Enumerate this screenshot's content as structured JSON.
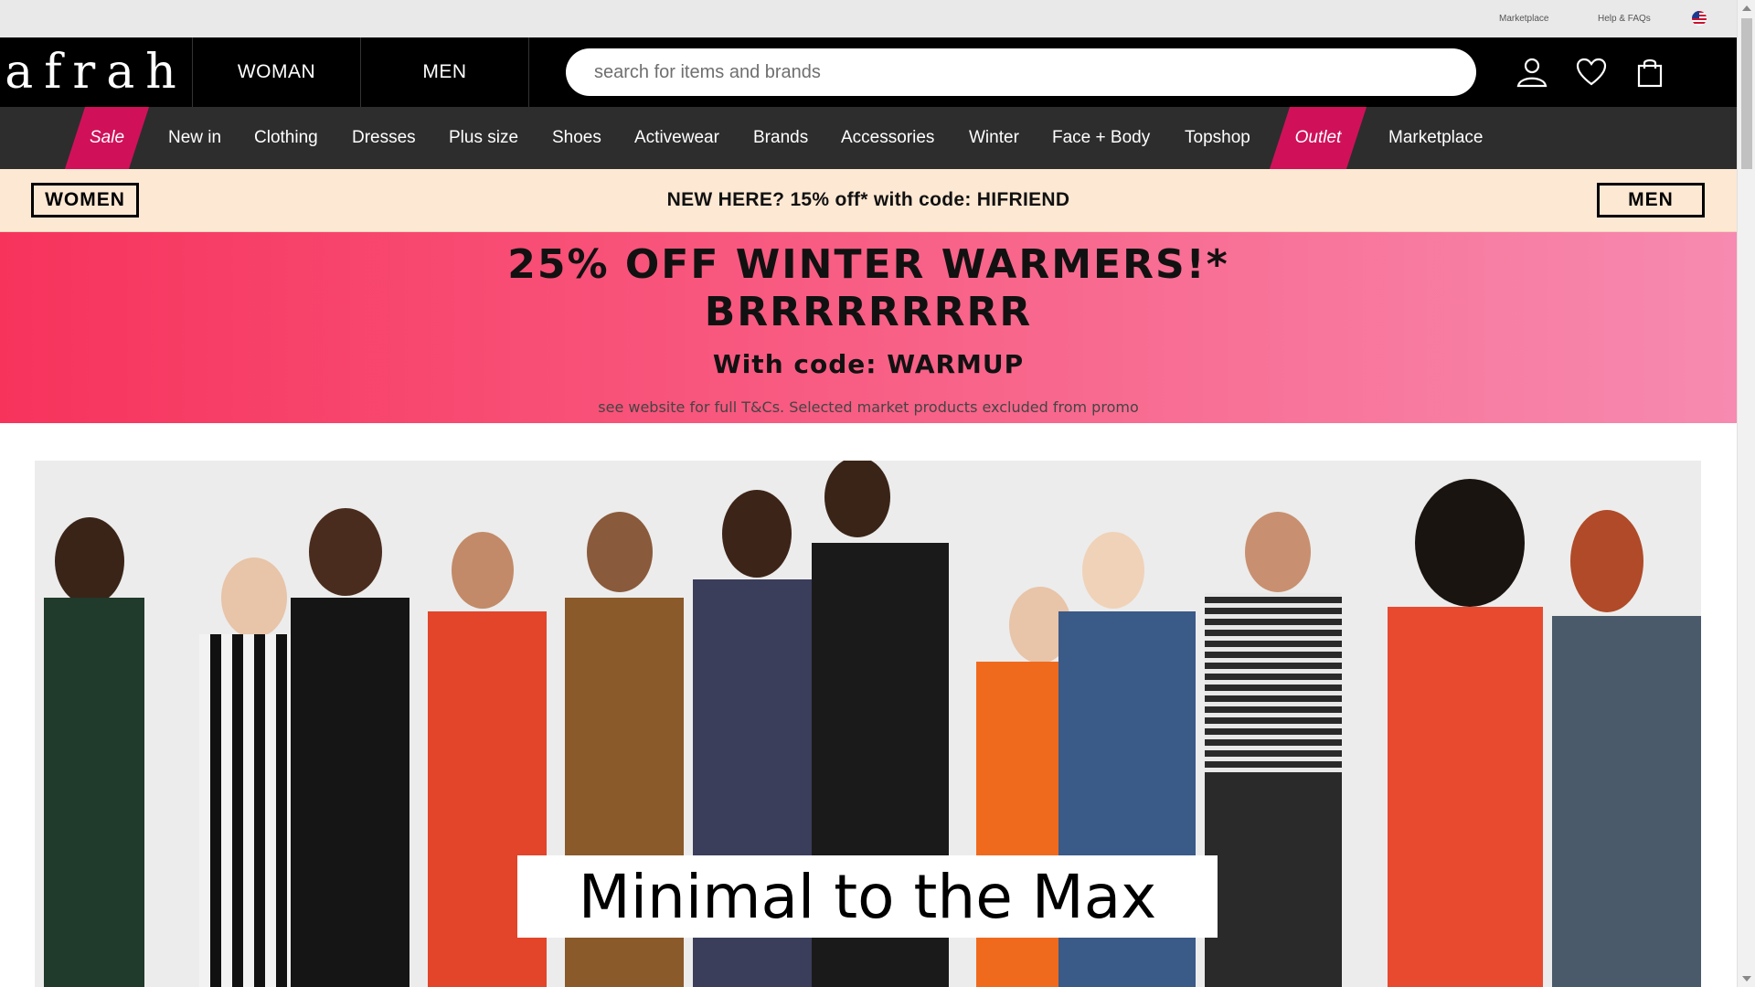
{
  "utility": {
    "marketplace": "Marketplace",
    "help": "Help & FAQs",
    "flag_icon": "us-flag-icon"
  },
  "header": {
    "logo": "afrah",
    "tabs": [
      "WOMAN",
      "MEN"
    ],
    "search_placeholder": "search for items and brands",
    "icons": [
      "account-icon",
      "heart-icon",
      "bag-icon"
    ]
  },
  "nav": {
    "items": [
      "Sale",
      "New in",
      "Clothing",
      "Dresses",
      "Plus size",
      "Shoes",
      "Activewear",
      "Brands",
      "Accessories",
      "Winter",
      "Face + Body",
      "Topshop",
      "Outlet",
      "Marketplace"
    ],
    "highlight_color": "#d0115a"
  },
  "promo": {
    "women_label": "WOMEN",
    "men_label": "MEN",
    "message": "NEW HERE? 15% off* with code: HIFRIEND"
  },
  "sale_banner": {
    "line1": "25% OFF WINTER WARMERS!*",
    "line2": "BRRRRRRRRR",
    "line3": "With code: WARMUP",
    "terms": "see website for full T&Cs. Selected market products excluded from promo"
  },
  "hero": {
    "caption": "Minimal to the Max"
  },
  "colors": {
    "accent": "#d0115a",
    "header_bg": "#000000",
    "nav_bg": "#2d2d2d",
    "promo_bg": "#fde8d3"
  }
}
